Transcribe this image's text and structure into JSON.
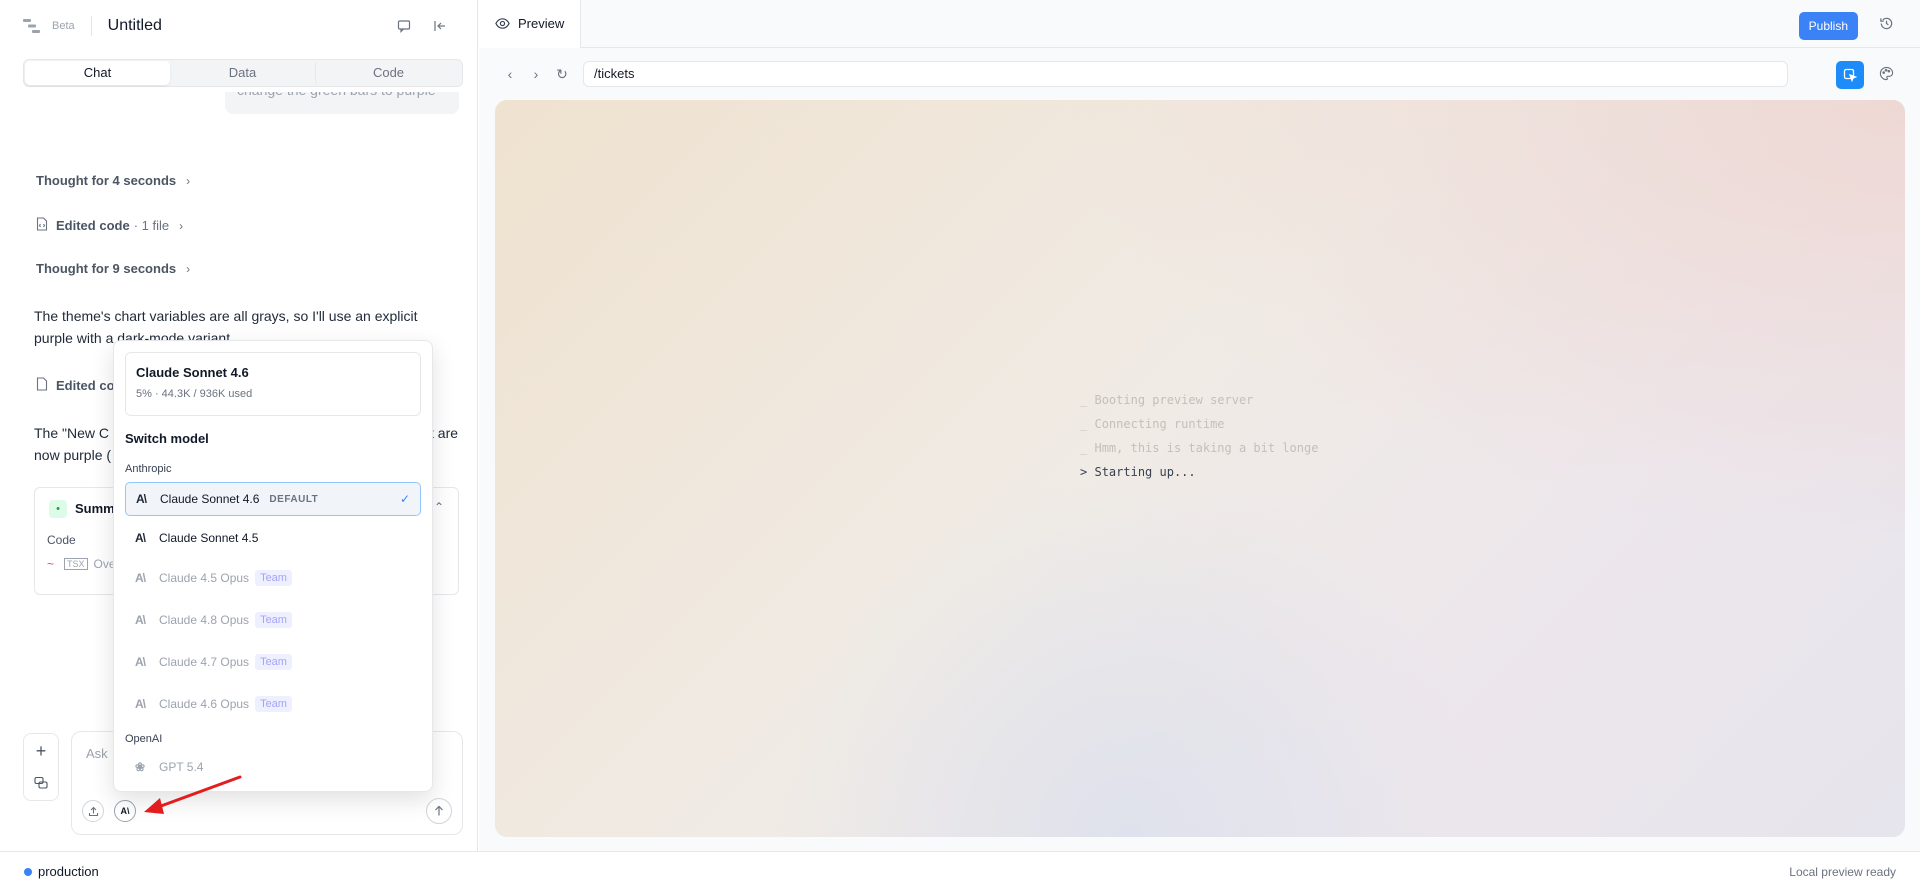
{
  "app": {
    "beta_label": "Beta",
    "project_title": "Untitled"
  },
  "tabs": [
    {
      "label": "Chat",
      "active": true
    },
    {
      "label": "Data",
      "active": false
    },
    {
      "label": "Code",
      "active": false
    }
  ],
  "chat": {
    "user_message_fragment": "change the green bars to purple",
    "steps": [
      {
        "title": "Thought for 4 seconds"
      },
      {
        "title": "Edited code",
        "detail": "· 1 file"
      },
      {
        "title": "Thought for 9 seconds"
      }
    ],
    "assistant_message_1": "The theme's chart variables are all grays, so I'll use an explicit purple with a dark-mode variant.",
    "edited_code_2": "Edited co",
    "assistant_message_2_left": "The \"New C",
    "assistant_message_2_left2": "now purple (",
    "assistant_message_2_right": "t are",
    "summary": {
      "label": "Summ",
      "code_label": "Code",
      "file_label": "Over"
    },
    "composer_placeholder": "Ask"
  },
  "model_picker": {
    "current_model": "Claude Sonnet 4.6",
    "usage": "5% · 44.3K / 936K used",
    "switch_label": "Switch model",
    "groups": [
      {
        "name": "Anthropic",
        "models": [
          {
            "name": "Claude Sonnet 4.6",
            "badge": "DEFAULT",
            "selected": true,
            "disabled": false
          },
          {
            "name": "Claude Sonnet 4.5",
            "badge": "",
            "selected": false,
            "disabled": false
          },
          {
            "name": "Claude 4.5 Opus",
            "badge": "Team",
            "selected": false,
            "disabled": true
          },
          {
            "name": "Claude 4.8 Opus",
            "badge": "Team",
            "selected": false,
            "disabled": true
          },
          {
            "name": "Claude 4.7 Opus",
            "badge": "Team",
            "selected": false,
            "disabled": true
          },
          {
            "name": "Claude 4.6 Opus",
            "badge": "Team",
            "selected": false,
            "disabled": true
          }
        ]
      },
      {
        "name": "OpenAI",
        "models": [
          {
            "name": "GPT 5.4",
            "badge": "",
            "selected": false,
            "disabled": true
          }
        ]
      }
    ]
  },
  "preview": {
    "tab_label": "Preview",
    "publish_label": "Publish",
    "url": "/tickets",
    "log": [
      {
        "prefix": "_",
        "text": "Booting preview server",
        "state": "done"
      },
      {
        "prefix": "_",
        "text": "Connecting runtime",
        "state": "done"
      },
      {
        "prefix": "_",
        "text": "Hmm, this is taking a bit longer",
        "state": "done"
      },
      {
        "prefix": ">",
        "text": "Starting up...",
        "state": "current"
      }
    ]
  },
  "status_bar": {
    "environment": "production",
    "status": "Local preview ready"
  },
  "colors": {
    "accent": "#3b82f6",
    "inspect_button": "#1d8cf8",
    "annotation_arrow": "#e11d1d"
  }
}
